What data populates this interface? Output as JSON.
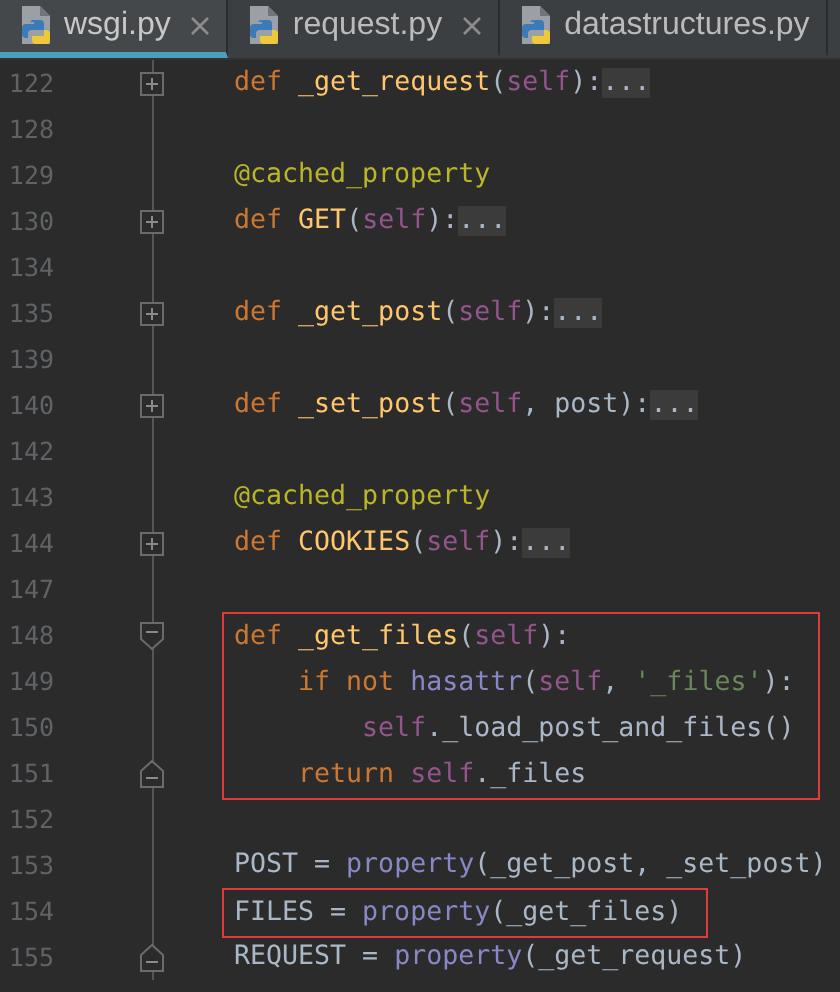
{
  "tabs": [
    {
      "label": "wsgi.py",
      "selected": true,
      "closable": true
    },
    {
      "label": "request.py",
      "selected": false,
      "closable": true
    },
    {
      "label": "datastructures.py",
      "selected": false,
      "closable": false
    }
  ],
  "lines": [
    {
      "number": "122",
      "collapsed": true,
      "fold_start": false,
      "fold_end": false,
      "highlighted": false,
      "tokens": [
        {
          "kind": "keyword",
          "text": "def "
        },
        {
          "kind": "function",
          "text": "_get_request"
        },
        {
          "kind": "plain",
          "text": "("
        },
        {
          "kind": "self",
          "text": "self"
        },
        {
          "kind": "plain",
          "text": "):"
        },
        {
          "kind": "folded",
          "text": "..."
        }
      ]
    },
    {
      "number": "128",
      "collapsed": false,
      "fold_start": false,
      "fold_end": false,
      "highlighted": false
    },
    {
      "number": "129",
      "collapsed": false,
      "fold_start": false,
      "fold_end": false,
      "highlighted": false,
      "tokens": [
        {
          "kind": "decorator",
          "text": "@cached_property"
        }
      ]
    },
    {
      "number": "130",
      "collapsed": true,
      "fold_start": false,
      "fold_end": false,
      "highlighted": false,
      "tokens": [
        {
          "kind": "keyword",
          "text": "def "
        },
        {
          "kind": "function",
          "text": "GET"
        },
        {
          "kind": "plain",
          "text": "("
        },
        {
          "kind": "self",
          "text": "self"
        },
        {
          "kind": "plain",
          "text": "):"
        },
        {
          "kind": "folded",
          "text": "..."
        }
      ]
    },
    {
      "number": "134",
      "collapsed": false,
      "fold_start": false,
      "fold_end": false,
      "highlighted": false
    },
    {
      "number": "135",
      "collapsed": true,
      "fold_start": false,
      "fold_end": false,
      "highlighted": false,
      "tokens": [
        {
          "kind": "keyword",
          "text": "def "
        },
        {
          "kind": "function",
          "text": "_get_post"
        },
        {
          "kind": "plain",
          "text": "("
        },
        {
          "kind": "self",
          "text": "self"
        },
        {
          "kind": "plain",
          "text": "):"
        },
        {
          "kind": "folded",
          "text": "..."
        }
      ]
    },
    {
      "number": "139",
      "collapsed": false,
      "fold_start": false,
      "fold_end": false,
      "highlighted": false
    },
    {
      "number": "140",
      "collapsed": true,
      "fold_start": false,
      "fold_end": false,
      "highlighted": false,
      "tokens": [
        {
          "kind": "keyword",
          "text": "def "
        },
        {
          "kind": "function",
          "text": "_set_post"
        },
        {
          "kind": "plain",
          "text": "("
        },
        {
          "kind": "self",
          "text": "self"
        },
        {
          "kind": "plain",
          "text": ", post):"
        },
        {
          "kind": "folded",
          "text": "..."
        }
      ]
    },
    {
      "number": "142",
      "collapsed": false,
      "fold_start": false,
      "fold_end": false,
      "highlighted": false
    },
    {
      "number": "143",
      "collapsed": false,
      "fold_start": false,
      "fold_end": false,
      "highlighted": false,
      "tokens": [
        {
          "kind": "decorator",
          "text": "@cached_property"
        }
      ]
    },
    {
      "number": "144",
      "collapsed": true,
      "fold_start": false,
      "fold_end": false,
      "highlighted": false,
      "tokens": [
        {
          "kind": "keyword",
          "text": "def "
        },
        {
          "kind": "function",
          "text": "COOKIES"
        },
        {
          "kind": "plain",
          "text": "("
        },
        {
          "kind": "self",
          "text": "self"
        },
        {
          "kind": "plain",
          "text": "):"
        },
        {
          "kind": "folded",
          "text": "..."
        }
      ]
    },
    {
      "number": "147",
      "collapsed": false,
      "fold_start": false,
      "fold_end": false,
      "highlighted": false
    },
    {
      "number": "148",
      "collapsed": false,
      "fold_start": true,
      "fold_end": false,
      "highlighted": true,
      "tokens": [
        {
          "kind": "keyword",
          "text": "def "
        },
        {
          "kind": "function",
          "text": "_get_files"
        },
        {
          "kind": "plain",
          "text": "("
        },
        {
          "kind": "self",
          "text": "self"
        },
        {
          "kind": "plain",
          "text": "):"
        }
      ]
    },
    {
      "number": "149",
      "collapsed": false,
      "fold_start": false,
      "fold_end": false,
      "highlighted": true,
      "tokens": [
        {
          "kind": "keyword",
          "text": "    if not "
        },
        {
          "kind": "builtin",
          "text": "hasattr"
        },
        {
          "kind": "plain",
          "text": "("
        },
        {
          "kind": "self",
          "text": "self"
        },
        {
          "kind": "plain",
          "text": ", "
        },
        {
          "kind": "string",
          "text": "'_files'"
        },
        {
          "kind": "plain",
          "text": "):"
        }
      ]
    },
    {
      "number": "150",
      "collapsed": false,
      "fold_start": false,
      "fold_end": false,
      "highlighted": true,
      "tokens": [
        {
          "kind": "self",
          "text": "        self"
        },
        {
          "kind": "plain",
          "text": "._load_post_and_files()"
        }
      ]
    },
    {
      "number": "151",
      "collapsed": false,
      "fold_start": false,
      "fold_end": true,
      "highlighted": true,
      "tokens": [
        {
          "kind": "keyword",
          "text": "    return "
        },
        {
          "kind": "self",
          "text": "self"
        },
        {
          "kind": "plain",
          "text": "._files"
        }
      ]
    },
    {
      "number": "152",
      "collapsed": false,
      "fold_start": false,
      "fold_end": false,
      "highlighted": false
    },
    {
      "number": "153",
      "collapsed": false,
      "fold_start": false,
      "fold_end": false,
      "highlighted": false,
      "tokens": [
        {
          "kind": "plain",
          "text": "POST = "
        },
        {
          "kind": "builtin",
          "text": "property"
        },
        {
          "kind": "plain",
          "text": "(_get_post, _set_post)"
        }
      ]
    },
    {
      "number": "154",
      "collapsed": false,
      "fold_start": false,
      "fold_end": false,
      "highlighted": true,
      "tokens": [
        {
          "kind": "plain",
          "text": "FILES = "
        },
        {
          "kind": "builtin",
          "text": "property"
        },
        {
          "kind": "plain",
          "text": "(_get_files)"
        }
      ]
    },
    {
      "number": "155",
      "collapsed": false,
      "fold_start": false,
      "fold_end": true,
      "highlighted": false,
      "tokens": [
        {
          "kind": "plain",
          "text": "REQUEST = "
        },
        {
          "kind": "builtin",
          "text": "property"
        },
        {
          "kind": "plain",
          "text": "(_get_request)"
        }
      ]
    }
  ]
}
